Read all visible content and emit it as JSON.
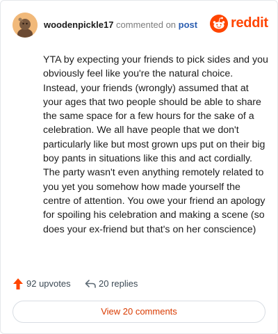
{
  "comment": {
    "username": "woodenpickle17",
    "verb": "commented on",
    "link_label": "post",
    "body": "YTA by expecting your friends to pick sides and you obviously feel like you're the natural choice. Instead, your friends (wrongly) assumed that at your ages that two people should be able to share the same space for a few hours for the sake of a celebration. We all have people that we don't particularly like but most grown ups put on their big boy pants in situations like this and act cordially. The party wasn't even anything remotely related to you yet you somehow how made yourself the centre of attention. You owe your friend an apology for spoiling his celebration and making a scene (so does your ex-friend but that's on her conscience)"
  },
  "brand": {
    "wordmark": "reddit",
    "icon": "reddit-snoo-icon",
    "color": "#ff4500"
  },
  "actions": {
    "upvotes_label": "92 upvotes",
    "upvote_icon": "upvote-arrow-icon",
    "replies_label": "20 replies",
    "reply_icon": "reply-arrow-icon"
  },
  "footer": {
    "view_comments_label": "View 20 comments"
  },
  "colors": {
    "accent": "#ff4500",
    "link": "#2a5db0",
    "button_text": "#d93a00"
  }
}
